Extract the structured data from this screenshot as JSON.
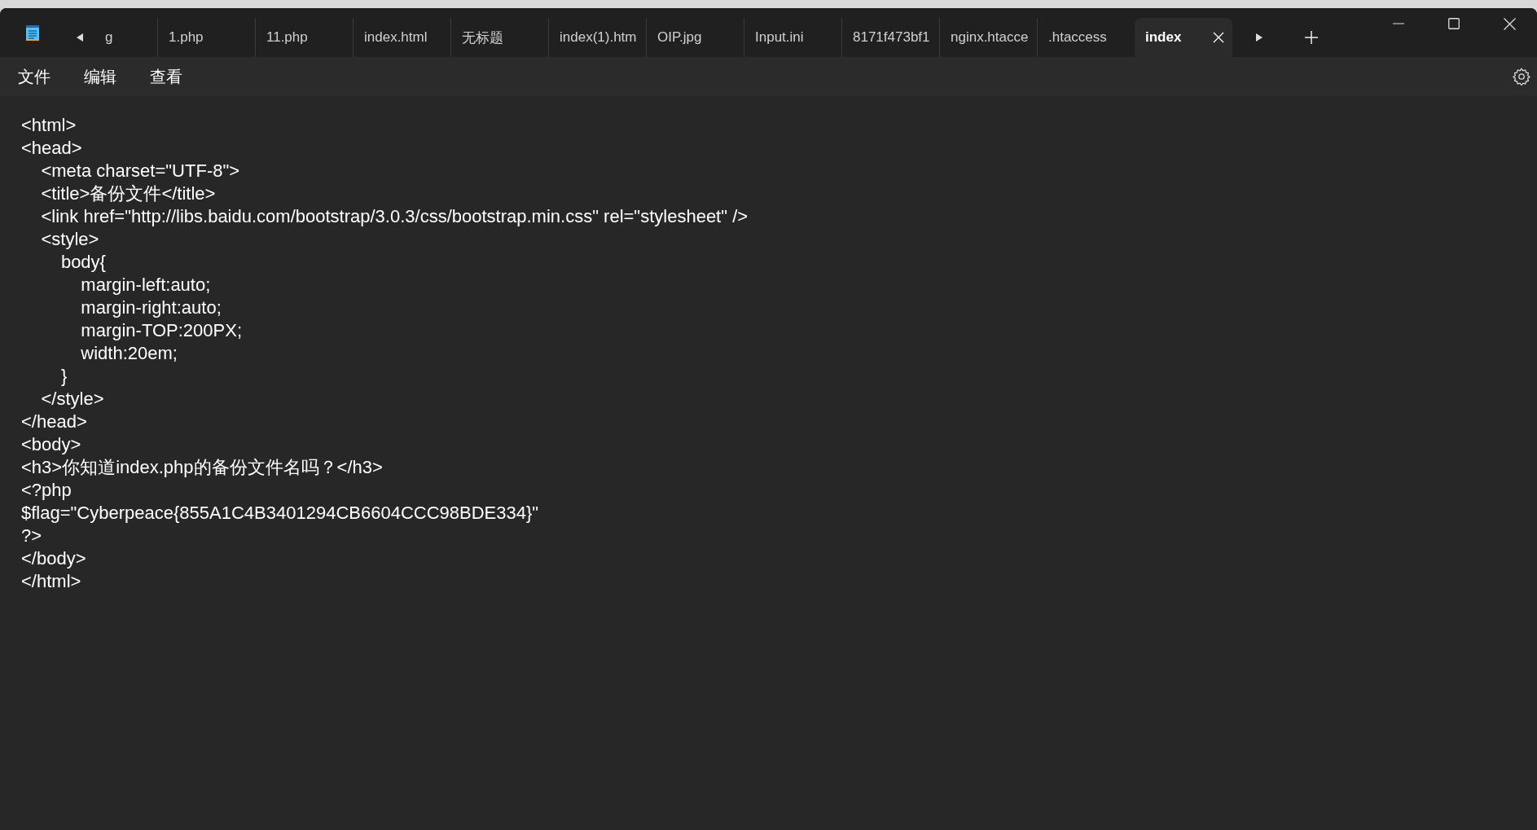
{
  "tabs": [
    {
      "label": "g",
      "selected": false
    },
    {
      "label": "1.php",
      "selected": false
    },
    {
      "label": "11.php",
      "selected": false
    },
    {
      "label": "index.html",
      "selected": false
    },
    {
      "label": "无标题",
      "selected": false
    },
    {
      "label": "index(1).htm",
      "selected": false
    },
    {
      "label": "OIP.jpg",
      "selected": false
    },
    {
      "label": "Input.ini",
      "selected": false
    },
    {
      "label": "8171f473bf1",
      "selected": false
    },
    {
      "label": "nginx.htacce",
      "selected": false
    },
    {
      "label": ".htaccess",
      "selected": false
    },
    {
      "label": "index",
      "selected": true
    }
  ],
  "menu": [
    "文件",
    "编辑",
    "查看"
  ],
  "editor": {
    "lines": [
      "<html>",
      "<head>",
      "    <meta charset=\"UTF-8\">",
      "    <title>备份文件</title>",
      "    <link href=\"http://libs.baidu.com/bootstrap/3.0.3/css/bootstrap.min.css\" rel=\"stylesheet\" />",
      "    <style>",
      "        body{",
      "            margin-left:auto;",
      "            margin-right:auto;",
      "            margin-TOP:200PX;",
      "            width:20em;",
      "        }",
      "    </style>",
      "</head>",
      "<body>",
      "<h3>你知道index.php的备份文件名吗？</h3>",
      "<?php",
      "$flag=\"Cyberpeace{855A1C4B3401294CB6604CCC98BDE334}\"",
      "?>",
      "</body>",
      "</html>"
    ]
  }
}
